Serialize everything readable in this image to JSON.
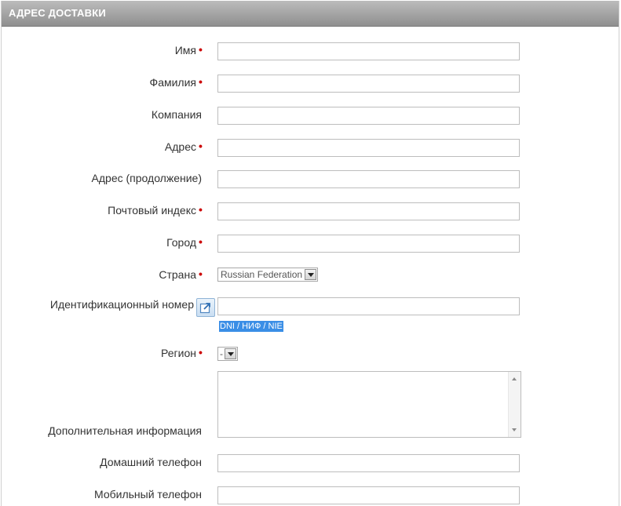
{
  "header": {
    "title": "АДРЕС ДОСТАВКИ"
  },
  "colors": {
    "required_star": "#cc0000",
    "hint_bg": "#3a8ee6"
  },
  "fields": {
    "first_name": {
      "label": "Имя",
      "required": true,
      "value": ""
    },
    "last_name": {
      "label": "Фамилия",
      "required": true,
      "value": ""
    },
    "company": {
      "label": "Компания",
      "required": false,
      "value": ""
    },
    "address": {
      "label": "Адрес",
      "required": true,
      "value": ""
    },
    "address2": {
      "label": "Адрес (продолжение)",
      "required": false,
      "value": ""
    },
    "postcode": {
      "label": "Почтовый индекс",
      "required": true,
      "value": ""
    },
    "city": {
      "label": "Город",
      "required": true,
      "value": ""
    },
    "country": {
      "label": "Страна",
      "required": true,
      "selected": "Russian Federation"
    },
    "dni": {
      "label": "Идентификационный номер",
      "required": false,
      "value": "",
      "hint": "DNI / НИФ / NIE"
    },
    "region": {
      "label": "Регион",
      "required": true,
      "selected": "-"
    },
    "other": {
      "label": "Дополнительная информация",
      "required": false,
      "value": ""
    },
    "phone": {
      "label": "Домашний телефон",
      "required": false,
      "value": ""
    },
    "phone_mobile": {
      "label": "Мобильный телефон",
      "required": false,
      "value": ""
    }
  },
  "required_marker": "•",
  "icons": {
    "dni_help": "external-link-icon"
  }
}
